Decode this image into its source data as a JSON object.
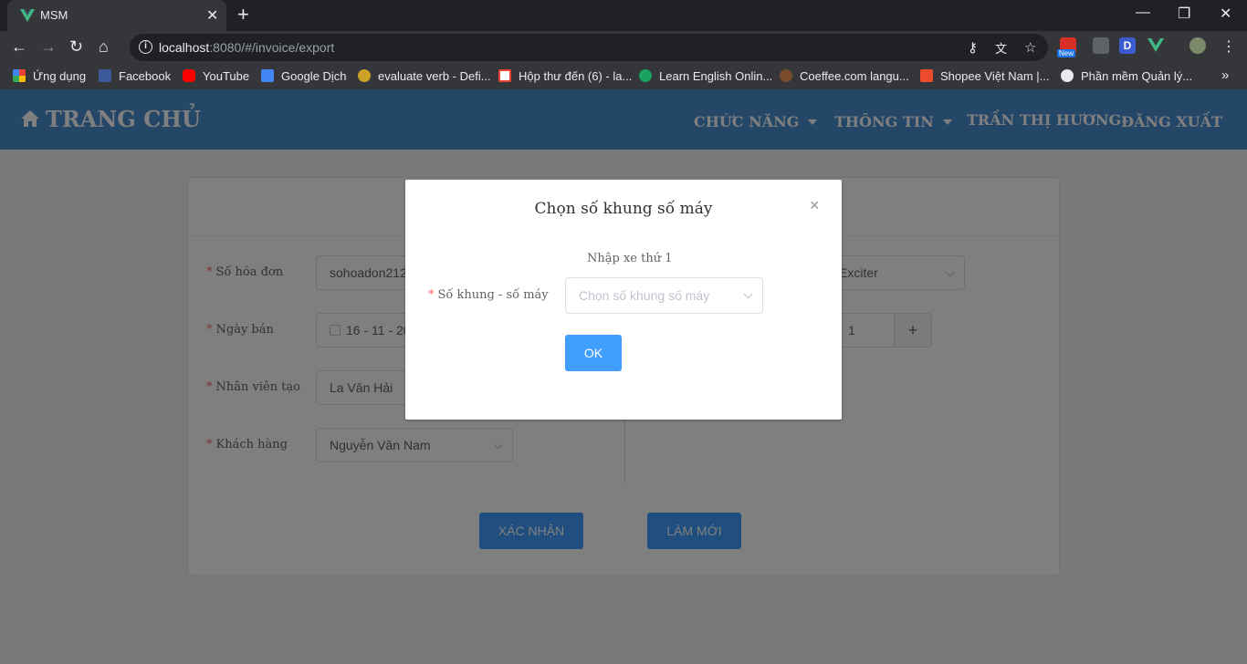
{
  "browser": {
    "tab_title": "MSM",
    "tab_close": "✕",
    "new_tab": "+",
    "url_host": "localhost",
    "url_rest": ":8080/#/invoice/export",
    "extensions": [
      "password-key-icon",
      "translate-icon",
      "bookmark-star-icon",
      "new-extension-icon",
      "pen-extension-icon",
      "d-extension-icon",
      "vue-devtools-icon",
      "profile-avatar"
    ],
    "ext_badge": "New",
    "ext_d": "D",
    "bookmarks": [
      {
        "label": "Ứng dụng",
        "color": "#e8453c"
      },
      {
        "label": "Facebook",
        "color": "#3b5998"
      },
      {
        "label": "YouTube",
        "color": "#ff0000"
      },
      {
        "label": "Google Dịch",
        "color": "#4285f4"
      },
      {
        "label": "evaluate verb - Defi...",
        "color": "#c9a227"
      },
      {
        "label": "Hộp thư đến (6) - la...",
        "color": "#ea4335"
      },
      {
        "label": "Learn English Onlin...",
        "color": "#1aa260"
      },
      {
        "label": "Coeffee.com langu...",
        "color": "#7a4a2a"
      },
      {
        "label": "Shopee Việt Nam |...",
        "color": "#ee4d2d"
      },
      {
        "label": "Phần mềm Quản lý...",
        "color": "#e8eaed"
      }
    ],
    "bookmarks_more": "»"
  },
  "app": {
    "brand": "TRANG CHỦ",
    "nav": [
      "CHỨC NĂNG",
      "THÔNG TIN",
      "TRẦN THỊ HƯƠNG",
      "ĐĂNG XUẤT"
    ],
    "form": {
      "required_mark": "*",
      "invoice_label": "Số hóa đơn",
      "invoice_value": "sohoadon212",
      "date_label": "Ngày bán",
      "date_value": "16 - 11 - 20",
      "staff_label": "Nhân viên tạo",
      "staff_value": "La Văn Hải",
      "customer_label": "Khách hàng",
      "customer_value": "Nguyễn Văn Nam",
      "model_value": "Exciter",
      "quantity_value": "1",
      "quantity_plus": "+",
      "confirm_button": "XÁC NHẬN",
      "reset_button": "LÀM MỚI"
    }
  },
  "modal": {
    "title": "Chọn số khung số máy",
    "close": "×",
    "subtitle": "Nhập xe thứ 1",
    "required_mark": "*",
    "label": "Số khung - số máy",
    "select_placeholder": "Chọn số khung số máy",
    "ok_button": "OK"
  }
}
